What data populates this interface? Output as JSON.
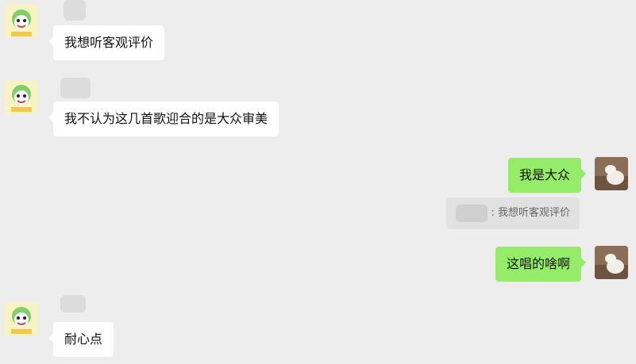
{
  "messages": [
    {
      "id": "m1",
      "side": "left",
      "text": "我想听客观评价"
    },
    {
      "id": "m2",
      "side": "left",
      "text": "我不认为这几首歌迎合的是大众审美"
    },
    {
      "id": "m3",
      "side": "right",
      "text": "我是大众"
    },
    {
      "id": "m3q",
      "quote_text": "我想听客观评价",
      "separator": ":"
    },
    {
      "id": "m4",
      "side": "right",
      "text": "这唱的啥啊"
    },
    {
      "id": "m5",
      "side": "left",
      "text": "耐心点"
    }
  ],
  "colors": {
    "background": "#ededed",
    "incoming_bubble": "#ffffff",
    "outgoing_bubble": "#95ec69",
    "quote_bg": "#e1e1e1"
  },
  "icons": {
    "left_avatar": "cartoon-avatar-icon",
    "right_avatar": "photo-avatar-icon"
  }
}
